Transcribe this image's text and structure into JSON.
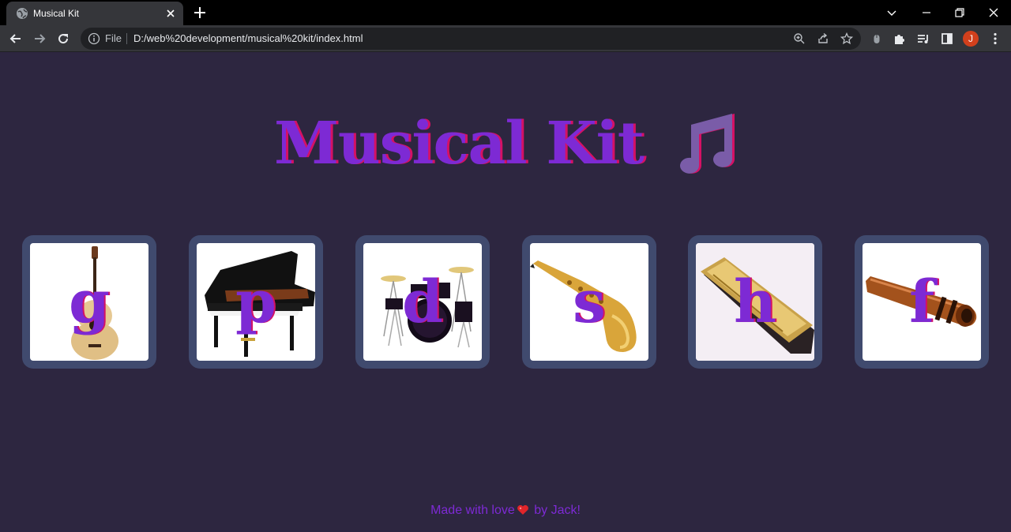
{
  "browser": {
    "tab_title": "Musical Kit",
    "file_label": "File",
    "url": "D:/web%20development/musical%20kit/index.html",
    "avatar_initial": "J"
  },
  "page": {
    "title": "Musical Kit",
    "drums": [
      {
        "key": "g",
        "instrument": "guitar-icon"
      },
      {
        "key": "p",
        "instrument": "piano-icon"
      },
      {
        "key": "d",
        "instrument": "drum-kit-icon"
      },
      {
        "key": "s",
        "instrument": "saxophone-icon"
      },
      {
        "key": "h",
        "instrument": "harmonica-icon"
      },
      {
        "key": "f",
        "instrument": "flute-icon"
      }
    ],
    "footer": {
      "before": "Made with love",
      "after": " by Jack!"
    }
  },
  "colors": {
    "background": "#2d2640",
    "accent": "#7d2ad4",
    "shadow": "#d51164",
    "frame": "#404a6e"
  }
}
